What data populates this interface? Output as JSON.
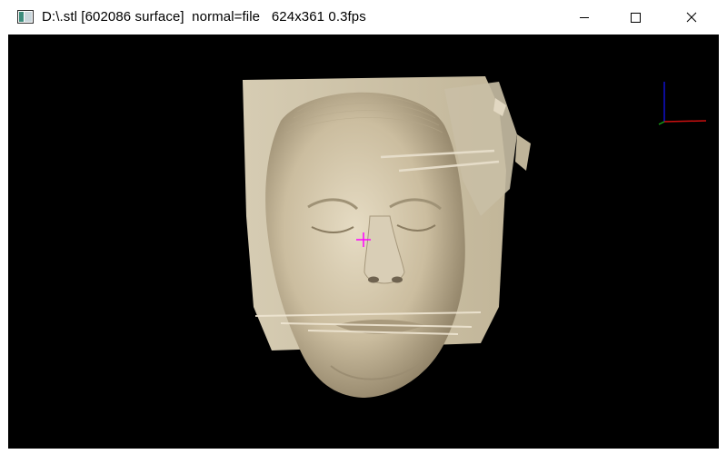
{
  "window": {
    "title": "D:\\.stl [602086 surface]  normal=file   624x361 0.3fps",
    "controls": {
      "minimize_icon": "minimize-icon",
      "maximize_icon": "maximize-icon",
      "close_icon": "close-icon"
    }
  },
  "viewport": {
    "background": "#000000",
    "surface_color": "#d8cdb4",
    "crosshair_color": "#ff00ff",
    "axes": {
      "x_color": "#cc0000",
      "y_color": "#0000cc",
      "z_color": "#00aa00"
    }
  }
}
